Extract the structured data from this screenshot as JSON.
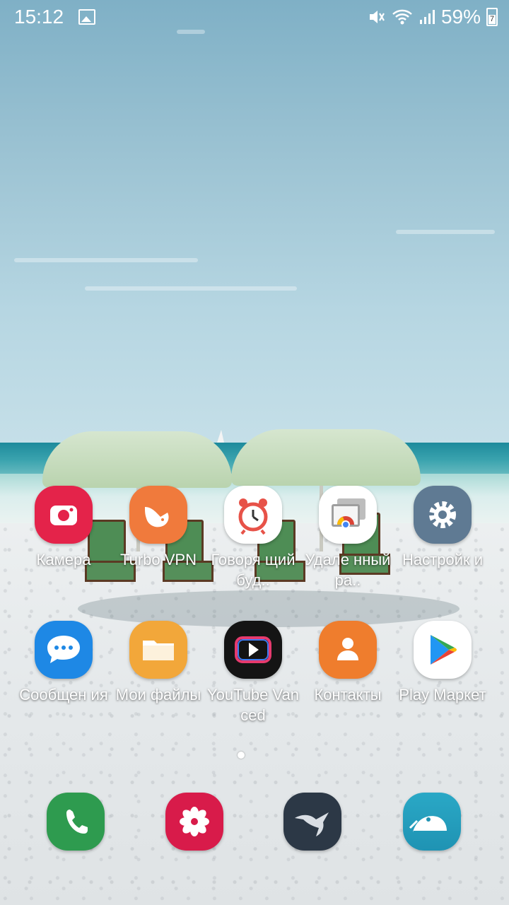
{
  "status_bar": {
    "time": "15:12",
    "battery_percent": "59%",
    "battery_badge": "7",
    "icons": [
      "gallery-notification-icon",
      "mute-icon",
      "wifi-icon",
      "signal-icon",
      "battery-icon"
    ]
  },
  "home": {
    "row1": [
      {
        "label": "Камера",
        "icon": "camera-icon",
        "color": "#e4234a"
      },
      {
        "label": "Turbo VPN",
        "icon": "turbo-vpn-icon",
        "color": "#f07a3c"
      },
      {
        "label": "Говорящий будильник",
        "display": "Говоря щий буд..",
        "icon": "alarm-clock-icon",
        "color": "#ffffff"
      },
      {
        "label": "Удаленный рабочий стол",
        "display": "Удале нный ра..",
        "icon": "chrome-remote-desktop-icon",
        "color": "#ffffff"
      },
      {
        "label": "Настройки",
        "display": "Настройк и",
        "icon": "settings-gear-icon",
        "color": "#5f7a93"
      }
    ],
    "row2": [
      {
        "label": "Сообщения",
        "display": "Сообщен ия",
        "icon": "messages-icon",
        "color": "#1e88e5"
      },
      {
        "label": "Мои файлы",
        "icon": "my-files-icon",
        "color": "#f2a73a"
      },
      {
        "label": "YouTube Vanced",
        "icon": "youtube-vanced-icon",
        "color": "#141414"
      },
      {
        "label": "Контакты",
        "icon": "contacts-icon",
        "color": "#ef7d2d"
      },
      {
        "label": "Play Маркет",
        "icon": "play-store-icon",
        "color": "#ffffff"
      }
    ],
    "dock": [
      {
        "name": "phone",
        "icon": "phone-icon",
        "color": "#2e9b4f"
      },
      {
        "name": "gallery",
        "icon": "gallery-flower-icon",
        "color": "#d81b4a"
      },
      {
        "name": "swift-app",
        "icon": "swift-bird-icon",
        "color": "#2c3846"
      },
      {
        "name": "kiwi-browser",
        "icon": "kiwi-bird-icon",
        "color": "#2aa8c6"
      }
    ]
  }
}
